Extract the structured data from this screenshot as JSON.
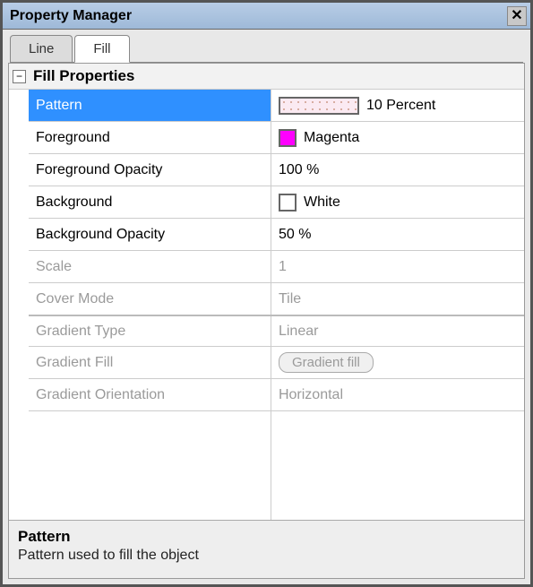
{
  "window": {
    "title": "Property Manager"
  },
  "tabs": {
    "line": "Line",
    "fill": "Fill"
  },
  "section": {
    "title": "Fill Properties",
    "collapse_glyph": "−"
  },
  "props": {
    "pattern": {
      "label": "Pattern",
      "value": "10 Percent",
      "swatch_type": "pattern"
    },
    "foreground": {
      "label": "Foreground",
      "value": "Magenta",
      "swatch_color": "#ff00ff"
    },
    "fg_opacity": {
      "label": "Foreground Opacity",
      "value": "100 %"
    },
    "background": {
      "label": "Background",
      "value": "White",
      "swatch_color": "#ffffff"
    },
    "bg_opacity": {
      "label": "Background Opacity",
      "value": "50 %"
    },
    "scale": {
      "label": "Scale",
      "value": "1"
    },
    "cover_mode": {
      "label": "Cover Mode",
      "value": "Tile"
    },
    "gradient_type": {
      "label": "Gradient Type",
      "value": "Linear"
    },
    "gradient_fill": {
      "label": "Gradient Fill",
      "button": "Gradient fill"
    },
    "gradient_orientation": {
      "label": "Gradient Orientation",
      "value": "Horizontal"
    }
  },
  "description": {
    "title": "Pattern",
    "text": "Pattern used to fill the object"
  }
}
